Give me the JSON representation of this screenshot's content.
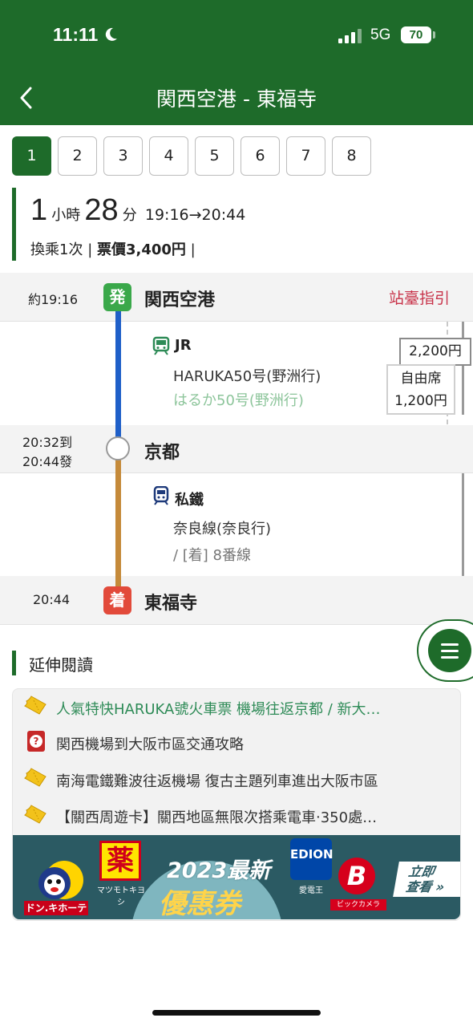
{
  "status_bar": {
    "time": "11:11",
    "network": "5G",
    "battery": "70"
  },
  "header": {
    "title": "関西空港 - 東福寺"
  },
  "route_tabs": [
    "1",
    "2",
    "3",
    "4",
    "5",
    "6",
    "7",
    "8"
  ],
  "active_tab": "1",
  "summary": {
    "hours": "1",
    "hours_unit": "小時",
    "minutes": "28",
    "minutes_unit": "分",
    "time_range": "19:16→20:44",
    "transfer": "換乘1次",
    "fare": "票價3,400円"
  },
  "timeline": {
    "departure": {
      "time": "約19:16",
      "badge": "発",
      "station": "関西空港",
      "guide_link": "站臺指引"
    },
    "leg1": {
      "operator": "JR",
      "train": "HARUKA50号(野洲行)",
      "train_jp": "はるか50号(野洲行)",
      "fare": "2,200円",
      "seat": "自由席",
      "seat_fare": "1,200円"
    },
    "transfer_station": {
      "arrive": "20:32到",
      "depart": "20:44發",
      "station": "京都"
    },
    "leg2": {
      "operator": "私鐵",
      "line": "奈良線(奈良行)",
      "platform": "/ [着] 8番線"
    },
    "arrival": {
      "time": "20:44",
      "badge": "着",
      "station": "東福寺"
    }
  },
  "further_reading": {
    "title": "延伸閱讀",
    "items": [
      "人氣特快HARUKA號火車票 機場往返京都 / 新大…",
      "関西機場到大阪市區交通攻略",
      "南海電鐵難波往返機場 復古主題列車進出大阪市區",
      "【關西周遊卡】關西地區無限次搭乘電車‧350處…"
    ]
  },
  "banner": {
    "year_text": "2023最新",
    "coupon_text": "優惠券",
    "brand_donki": "ドン.キホーテ",
    "brand_yaku": "薬",
    "brand_yaku_sub": "マツモトキヨシ",
    "brand_edion": "EDION",
    "brand_edion_sub": "愛電王",
    "brand_bic": "B",
    "brand_bic_sub": "ビックカメラ",
    "cta": "立即\n查看 »"
  },
  "colors": {
    "header": "#1e6b2a",
    "depart_badge": "#3aa84a",
    "arrive_badge": "#e24a3a",
    "jr_line": "#1f5fc8",
    "private_line": "#c58a3a",
    "guide_link": "#c8334a"
  },
  "icons": [
    "back-icon",
    "moon-icon",
    "signal-icon",
    "train-icon",
    "subway-icon",
    "menu-icon",
    "ticket-icon",
    "book-icon"
  ]
}
